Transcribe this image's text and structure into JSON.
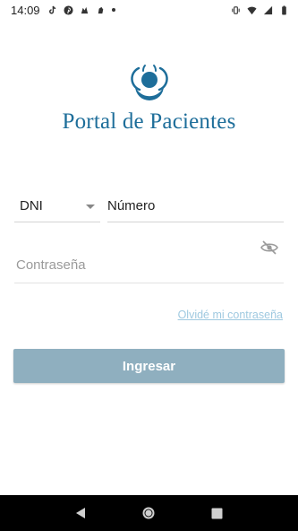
{
  "status_bar": {
    "time": "14:09",
    "notification_icons": [
      "tiktok-icon",
      "pinterest-icon",
      "app-icon",
      "app-icon"
    ],
    "right_icons": [
      "vibrate-icon",
      "wifi-icon",
      "signal-icon",
      "battery-icon"
    ]
  },
  "brand": {
    "name": "Portal de Pacientes",
    "color": "#1e6e9a"
  },
  "form": {
    "doc_type_value": "DNI",
    "number_placeholder": "Número",
    "password_placeholder": "Contraseña",
    "forgot_label": "Olvidé mi contraseña",
    "submit_label": "Ingresar"
  },
  "colors": {
    "button": "#8fafbf",
    "link": "#9fc9e0"
  }
}
